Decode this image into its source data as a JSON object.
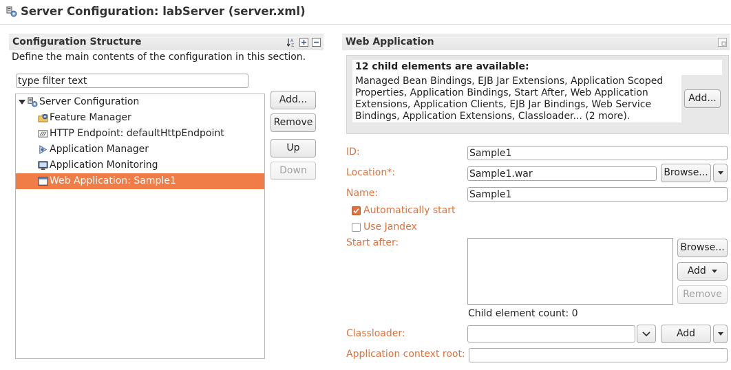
{
  "header": {
    "title": "Server Configuration: labServer (server.xml)"
  },
  "left": {
    "section_title": "Configuration Structure",
    "description": "Define the main contents of the configuration in this section.",
    "filter_placeholder": "type filter text",
    "tree": [
      {
        "label": "Server Configuration",
        "icon": "server-config-icon"
      },
      {
        "label": "Feature Manager",
        "icon": "feature-manager-icon"
      },
      {
        "label": "HTTP Endpoint: defaultHttpEndpoint",
        "icon": "http-endpoint-icon"
      },
      {
        "label": "Application Manager",
        "icon": "application-manager-icon"
      },
      {
        "label": "Application Monitoring",
        "icon": "monitor-icon"
      },
      {
        "label": "Web Application: Sample1",
        "icon": "web-app-icon",
        "selected": true
      }
    ],
    "buttons": {
      "add": "Add...",
      "remove": "Remove",
      "up": "Up",
      "down": "Down"
    }
  },
  "right": {
    "section_title": "Web Application",
    "child_info": {
      "heading": "12 child elements are available:",
      "text": "Managed Bean Bindings, EJB Jar Extensions, Application Scoped Properties, Application Bindings, Start After, Web Application Extensions, Application Clients, EJB Jar Bindings, Web Service Bindings, Application Extensions, Classloader... (2 more).",
      "add_button": "Add..."
    },
    "form": {
      "id_label": "ID:",
      "id_value": "Sample1",
      "location_label": "Location*:",
      "location_value": "Sample1.war",
      "browse_button": "Browse...",
      "name_label": "Name:",
      "name_value": "Sample1",
      "auto_start_label": "Automatically start",
      "auto_start_checked": true,
      "use_jandex_label": "Use Jandex",
      "use_jandex_checked": false,
      "start_after_label": "Start after:",
      "start_after_browse": "Browse...",
      "start_after_add": "Add",
      "start_after_remove": "Remove",
      "child_count": "Child element count: 0",
      "classloader_label": "Classloader:",
      "classloader_value": "",
      "classloader_add": "Add",
      "context_root_label": "Application context root:",
      "context_root_value": ""
    }
  },
  "colors": {
    "accent": "#f07c47",
    "label": "#e0713d",
    "section_bar": "#e8e8e8"
  }
}
